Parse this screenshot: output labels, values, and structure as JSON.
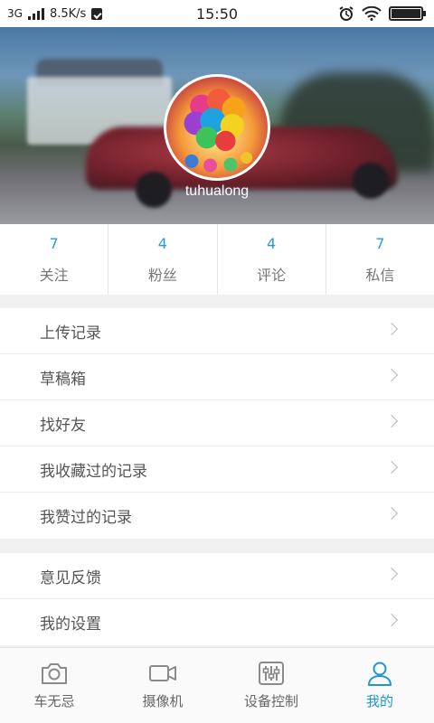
{
  "status_bar": {
    "network": "3G",
    "speed": "8.5K/s",
    "time": "15:50"
  },
  "profile": {
    "username": "tuhualong"
  },
  "stats": [
    {
      "value": "7",
      "label": "关注"
    },
    {
      "value": "4",
      "label": "粉丝"
    },
    {
      "value": "4",
      "label": "评论"
    },
    {
      "value": "7",
      "label": "私信"
    }
  ],
  "menu_group_1": [
    {
      "label": "上传记录"
    },
    {
      "label": "草稿箱"
    },
    {
      "label": "找好友"
    },
    {
      "label": "我收藏过的记录"
    },
    {
      "label": "我赞过的记录"
    }
  ],
  "menu_group_2": [
    {
      "label": "意见反馈"
    },
    {
      "label": "我的设置"
    }
  ],
  "tabbar": {
    "tabs": [
      {
        "label": "车无忌",
        "icon": "camera-icon"
      },
      {
        "label": "摄像机",
        "icon": "video-camera-icon"
      },
      {
        "label": "设备控制",
        "icon": "sliders-icon"
      },
      {
        "label": "我的",
        "icon": "person-icon"
      }
    ],
    "active_index": 3
  },
  "colors": {
    "accent": "#1e96d6",
    "stat_value": "#2a9bd6"
  }
}
